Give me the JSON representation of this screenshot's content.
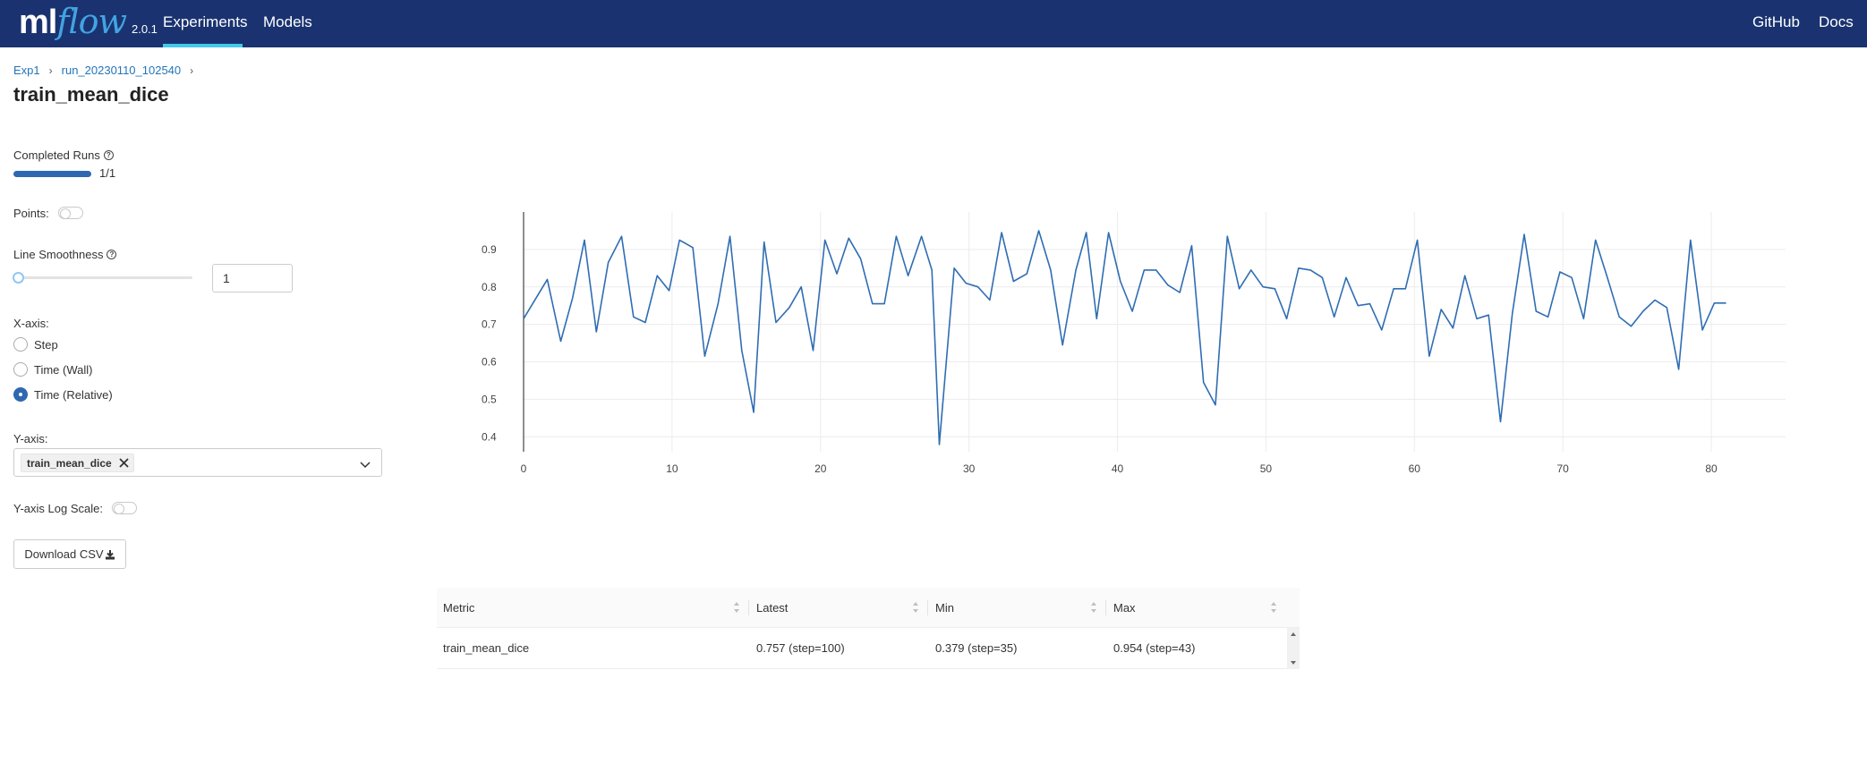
{
  "header": {
    "logo_ml": "ml",
    "logo_flow": "flow",
    "version": "2.0.1",
    "nav": {
      "experiments": "Experiments",
      "models": "Models",
      "github": "GitHub",
      "docs": "Docs"
    }
  },
  "breadcrumb": {
    "experiment": "Exp1",
    "run": "run_20230110_102540",
    "separator": "›"
  },
  "page_title": "train_mean_dice",
  "controls": {
    "completed_runs_label": "Completed Runs",
    "completed_runs_value": "1/1",
    "completed_runs_fraction": 1.0,
    "points_label": "Points:",
    "points_enabled": false,
    "line_smoothness_label": "Line Smoothness",
    "line_smoothness_value": "1",
    "xaxis_label": "X-axis:",
    "xaxis_options": [
      "Step",
      "Time (Wall)",
      "Time (Relative)"
    ],
    "xaxis_selected": "Time (Relative)",
    "yaxis_label": "Y-axis:",
    "yaxis_selected": "train_mean_dice",
    "yaxis_log_label": "Y-axis Log Scale:",
    "yaxis_log_enabled": false,
    "download_label": "Download CSV"
  },
  "chart_data": {
    "type": "line",
    "series": [
      {
        "color": "#2f6db3",
        "x": [
          0,
          1.6,
          2.5,
          3.3,
          4.1,
          4.9,
          5.7,
          6.6,
          7.4,
          8.2,
          9.0,
          9.8,
          10.5,
          11.4,
          12.2,
          13.1,
          13.9,
          14.7,
          15.5,
          16.2,
          17.0,
          17.9,
          18.7,
          19.5,
          20.3,
          21.1,
          21.9,
          22.7,
          23.5,
          24.3,
          25.1,
          25.9,
          26.8,
          27.5,
          28.0,
          29.0,
          29.8,
          30.6,
          31.4,
          32.2,
          33.0,
          33.9,
          34.7,
          35.5,
          36.3,
          37.2,
          37.9,
          38.6,
          39.4,
          40.2,
          41.0,
          41.8,
          42.6,
          43.4,
          44.2,
          45.0,
          45.8,
          46.6,
          47.4,
          48.2,
          49.0,
          49.8,
          50.6,
          51.4,
          52.2,
          53.0,
          53.8,
          54.6,
          55.4,
          56.2,
          57.0,
          57.8,
          58.6,
          59.4,
          60.2,
          61.0,
          61.8,
          62.6,
          63.4,
          64.2,
          65.0,
          65.8,
          66.6,
          67.4,
          68.2,
          69.0,
          69.8,
          70.6,
          71.4,
          72.2,
          73.0,
          73.8,
          74.6,
          75.4,
          76.2,
          77.0,
          77.8,
          78.6,
          79.4,
          80.2,
          81.0
        ],
        "y": [
          0.715,
          0.82,
          0.655,
          0.77,
          0.925,
          0.68,
          0.865,
          0.935,
          0.72,
          0.705,
          0.83,
          0.79,
          0.925,
          0.905,
          0.615,
          0.755,
          0.935,
          0.63,
          0.465,
          0.92,
          0.705,
          0.745,
          0.8,
          0.63,
          0.925,
          0.835,
          0.93,
          0.875,
          0.755,
          0.755,
          0.935,
          0.83,
          0.935,
          0.845,
          0.379,
          0.85,
          0.81,
          0.8,
          0.765,
          0.945,
          0.815,
          0.835,
          0.95,
          0.845,
          0.645,
          0.845,
          0.945,
          0.715,
          0.945,
          0.815,
          0.735,
          0.845,
          0.845,
          0.805,
          0.785,
          0.91,
          0.545,
          0.485,
          0.935,
          0.795,
          0.845,
          0.8,
          0.795,
          0.715,
          0.85,
          0.845,
          0.825,
          0.72,
          0.825,
          0.75,
          0.755,
          0.685,
          0.795,
          0.795,
          0.925,
          0.615,
          0.74,
          0.69,
          0.83,
          0.715,
          0.725,
          0.44,
          0.73,
          0.94,
          0.735,
          0.72,
          0.84,
          0.825,
          0.715,
          0.925,
          0.825,
          0.72,
          0.695,
          0.735,
          0.765,
          0.745,
          0.58,
          0.925,
          0.685,
          0.757,
          0.757
        ]
      }
    ],
    "xlim": [
      0,
      85
    ],
    "ylim": [
      0.36,
      1.0
    ],
    "xticks": [
      0,
      10,
      20,
      30,
      40,
      50,
      60,
      70,
      80
    ],
    "yticks": [
      0.4,
      0.5,
      0.6,
      0.7,
      0.8,
      0.9
    ],
    "grid": true,
    "title": "",
    "xlabel": "",
    "ylabel": ""
  },
  "table": {
    "columns": [
      "Metric",
      "Latest",
      "Min",
      "Max"
    ],
    "rows": [
      {
        "metric": "train_mean_dice",
        "latest": "0.757 (step=100)",
        "min": "0.379 (step=35)",
        "max": "0.954 (step=43)"
      }
    ]
  },
  "colors": {
    "header_bg": "#1a3370",
    "accent": "#43c9ed",
    "link": "#2374bb",
    "line": "#2f6db3"
  }
}
